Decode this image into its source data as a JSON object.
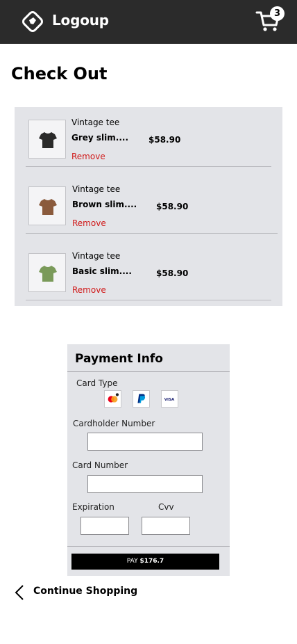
{
  "header": {
    "brand": "Logoup",
    "cart_count": "3"
  },
  "page": {
    "title": "Check Out"
  },
  "cart": {
    "items": [
      {
        "line1": "Vintage tee",
        "line2": "Grey slim....",
        "price": "$58.90",
        "remove": "Remove",
        "color": "#2a2a2a"
      },
      {
        "line1": "Vintage tee",
        "line2": "Brown slim....",
        "price": "$58.90",
        "remove": "Remove",
        "color": "#8a5a3c"
      },
      {
        "line1": "Vintage tee",
        "line2": "Basic slim....",
        "price": "$58.90",
        "remove": "Remove",
        "color": "#7a9a5a"
      }
    ]
  },
  "payment": {
    "title": "Payment Info",
    "card_type_label": "Card Type",
    "card_logos": [
      "mastercard-icon",
      "paypal-icon",
      "visa-icon"
    ],
    "cardholder_label": "Cardholder Number",
    "cardholder_value": "",
    "card_number_label": "Card Number",
    "card_number_value": "",
    "expiration_label": "Expiration",
    "expiration_value": "",
    "cvv_label": "Cvv",
    "cvv_value": "",
    "pay_prefix": "PAY",
    "pay_amount": "$176.7"
  },
  "footer": {
    "continue_label": "Continue Shopping"
  },
  "colors": {
    "topbar": "#2b2b2b",
    "panel": "#e3e4e8",
    "remove": "#d01a1a"
  }
}
